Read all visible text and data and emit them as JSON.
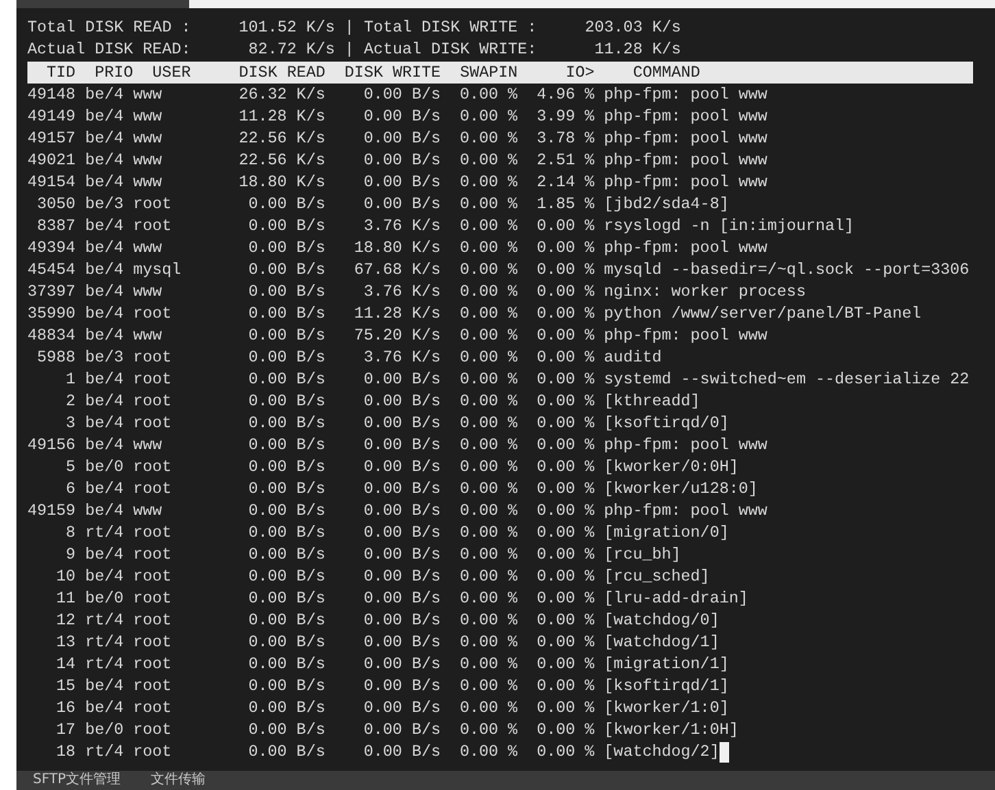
{
  "summary": [
    {
      "read_label": "Total DISK READ :",
      "read_value": "101.52 K/s",
      "separator": "|",
      "write_label": "Total DISK WRITE :",
      "write_value": "203.03 K/s"
    },
    {
      "read_label": "Actual DISK READ:",
      "read_value": "82.72 K/s",
      "separator": "|",
      "write_label": "Actual DISK WRITE:",
      "write_value": "11.28 K/s"
    }
  ],
  "columns": [
    "TID",
    "PRIO",
    "USER",
    "DISK READ",
    "DISK WRITE",
    "SWAPIN",
    "IO>",
    "COMMAND"
  ],
  "rows": [
    [
      "49148",
      "be/4",
      "www",
      "26.32 K/s",
      "0.00 B/s",
      "0.00 %",
      "4.96 %",
      "php-fpm: pool www"
    ],
    [
      "49149",
      "be/4",
      "www",
      "11.28 K/s",
      "0.00 B/s",
      "0.00 %",
      "3.99 %",
      "php-fpm: pool www"
    ],
    [
      "49157",
      "be/4",
      "www",
      "22.56 K/s",
      "0.00 B/s",
      "0.00 %",
      "3.78 %",
      "php-fpm: pool www"
    ],
    [
      "49021",
      "be/4",
      "www",
      "22.56 K/s",
      "0.00 B/s",
      "0.00 %",
      "2.51 %",
      "php-fpm: pool www"
    ],
    [
      "49154",
      "be/4",
      "www",
      "18.80 K/s",
      "0.00 B/s",
      "0.00 %",
      "2.14 %",
      "php-fpm: pool www"
    ],
    [
      "3050",
      "be/3",
      "root",
      "0.00 B/s",
      "0.00 B/s",
      "0.00 %",
      "1.85 %",
      "[jbd2/sda4-8]"
    ],
    [
      "8387",
      "be/4",
      "root",
      "0.00 B/s",
      "3.76 K/s",
      "0.00 %",
      "0.00 %",
      "rsyslogd -n [in:imjournal]"
    ],
    [
      "49394",
      "be/4",
      "www",
      "0.00 B/s",
      "18.80 K/s",
      "0.00 %",
      "0.00 %",
      "php-fpm: pool www"
    ],
    [
      "45454",
      "be/4",
      "mysql",
      "0.00 B/s",
      "67.68 K/s",
      "0.00 %",
      "0.00 %",
      "mysqld --basedir=/~ql.sock --port=3306"
    ],
    [
      "37397",
      "be/4",
      "www",
      "0.00 B/s",
      "3.76 K/s",
      "0.00 %",
      "0.00 %",
      "nginx: worker process"
    ],
    [
      "35990",
      "be/4",
      "root",
      "0.00 B/s",
      "11.28 K/s",
      "0.00 %",
      "0.00 %",
      "python /www/server/panel/BT-Panel"
    ],
    [
      "48834",
      "be/4",
      "www",
      "0.00 B/s",
      "75.20 K/s",
      "0.00 %",
      "0.00 %",
      "php-fpm: pool www"
    ],
    [
      "5988",
      "be/3",
      "root",
      "0.00 B/s",
      "3.76 K/s",
      "0.00 %",
      "0.00 %",
      "auditd"
    ],
    [
      "1",
      "be/4",
      "root",
      "0.00 B/s",
      "0.00 B/s",
      "0.00 %",
      "0.00 %",
      "systemd --switched~em --deserialize 22"
    ],
    [
      "2",
      "be/4",
      "root",
      "0.00 B/s",
      "0.00 B/s",
      "0.00 %",
      "0.00 %",
      "[kthreadd]"
    ],
    [
      "3",
      "be/4",
      "root",
      "0.00 B/s",
      "0.00 B/s",
      "0.00 %",
      "0.00 %",
      "[ksoftirqd/0]"
    ],
    [
      "49156",
      "be/4",
      "www",
      "0.00 B/s",
      "0.00 B/s",
      "0.00 %",
      "0.00 %",
      "php-fpm: pool www"
    ],
    [
      "5",
      "be/0",
      "root",
      "0.00 B/s",
      "0.00 B/s",
      "0.00 %",
      "0.00 %",
      "[kworker/0:0H]"
    ],
    [
      "6",
      "be/4",
      "root",
      "0.00 B/s",
      "0.00 B/s",
      "0.00 %",
      "0.00 %",
      "[kworker/u128:0]"
    ],
    [
      "49159",
      "be/4",
      "www",
      "0.00 B/s",
      "0.00 B/s",
      "0.00 %",
      "0.00 %",
      "php-fpm: pool www"
    ],
    [
      "8",
      "rt/4",
      "root",
      "0.00 B/s",
      "0.00 B/s",
      "0.00 %",
      "0.00 %",
      "[migration/0]"
    ],
    [
      "9",
      "be/4",
      "root",
      "0.00 B/s",
      "0.00 B/s",
      "0.00 %",
      "0.00 %",
      "[rcu_bh]"
    ],
    [
      "10",
      "be/4",
      "root",
      "0.00 B/s",
      "0.00 B/s",
      "0.00 %",
      "0.00 %",
      "[rcu_sched]"
    ],
    [
      "11",
      "be/0",
      "root",
      "0.00 B/s",
      "0.00 B/s",
      "0.00 %",
      "0.00 %",
      "[lru-add-drain]"
    ],
    [
      "12",
      "rt/4",
      "root",
      "0.00 B/s",
      "0.00 B/s",
      "0.00 %",
      "0.00 %",
      "[watchdog/0]"
    ],
    [
      "13",
      "rt/4",
      "root",
      "0.00 B/s",
      "0.00 B/s",
      "0.00 %",
      "0.00 %",
      "[watchdog/1]"
    ],
    [
      "14",
      "rt/4",
      "root",
      "0.00 B/s",
      "0.00 B/s",
      "0.00 %",
      "0.00 %",
      "[migration/1]"
    ],
    [
      "15",
      "be/4",
      "root",
      "0.00 B/s",
      "0.00 B/s",
      "0.00 %",
      "0.00 %",
      "[ksoftirqd/1]"
    ],
    [
      "16",
      "be/4",
      "root",
      "0.00 B/s",
      "0.00 B/s",
      "0.00 %",
      "0.00 %",
      "[kworker/1:0]"
    ],
    [
      "17",
      "be/0",
      "root",
      "0.00 B/s",
      "0.00 B/s",
      "0.00 %",
      "0.00 %",
      "[kworker/1:0H]"
    ],
    [
      "18",
      "rt/4",
      "root",
      "0.00 B/s",
      "0.00 B/s",
      "0.00 %",
      "0.00 %",
      "[watchdog/2]"
    ]
  ],
  "bottom_tabs": [
    {
      "label": "SFTP文件管理",
      "selected": false
    },
    {
      "label": "文件传输",
      "selected": false
    }
  ]
}
